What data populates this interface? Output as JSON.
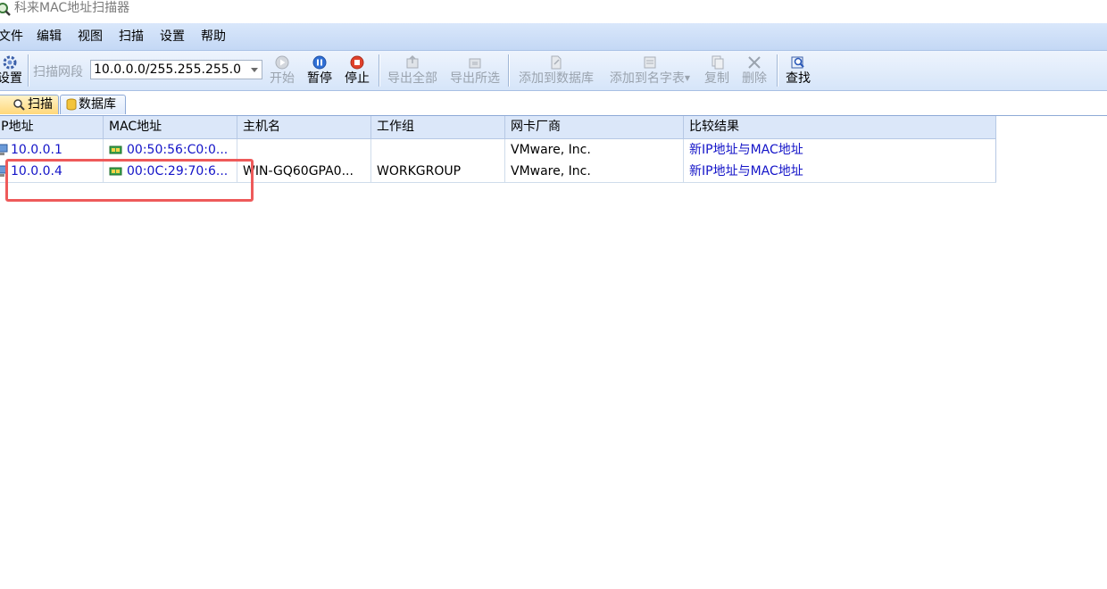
{
  "window": {
    "title": "科来MAC地址扫描器",
    "app_icon": "magnifier-network-icon"
  },
  "menu": [
    "文件",
    "编辑",
    "视图",
    "扫描",
    "设置",
    "帮助"
  ],
  "toolbar": {
    "settings_label": "设置",
    "range_label": "扫描网段",
    "range_value": "10.0.0.0/255.255.255.0",
    "start_label": "开始",
    "pause_label": "暂停",
    "stop_label": "停止",
    "export_all_label": "导出全部",
    "export_selected_label": "导出所选",
    "add_db_label": "添加到数据库",
    "add_names_label": "添加到名字表",
    "copy_label": "复制",
    "delete_label": "删除",
    "find_label": "查找"
  },
  "tabs": [
    {
      "label": "扫描",
      "active": true,
      "icon": "search-icon"
    },
    {
      "label": "数据库",
      "active": false,
      "icon": "database-icon"
    }
  ],
  "table": {
    "columns": [
      "IP地址",
      "MAC地址",
      "主机名",
      "工作组",
      "网卡厂商",
      "比较结果"
    ],
    "rows": [
      {
        "ip": "10.0.0.1",
        "mac": "00:50:56:C0:0...",
        "host": "",
        "workgroup": "",
        "vendor": "VMware, Inc.",
        "result": "新IP地址与MAC地址"
      },
      {
        "ip": "10.0.0.4",
        "mac": "00:0C:29:70:6...",
        "host": "WIN-GQ60GPA0...",
        "workgroup": "WORKGROUP",
        "vendor": "VMware, Inc.",
        "result": "新IP地址与MAC地址"
      }
    ]
  },
  "colors": {
    "link": "#1414c8",
    "highlight": "#ee5a5a",
    "menubar": "#c4d8f5",
    "header": "#dbe7f9"
  }
}
